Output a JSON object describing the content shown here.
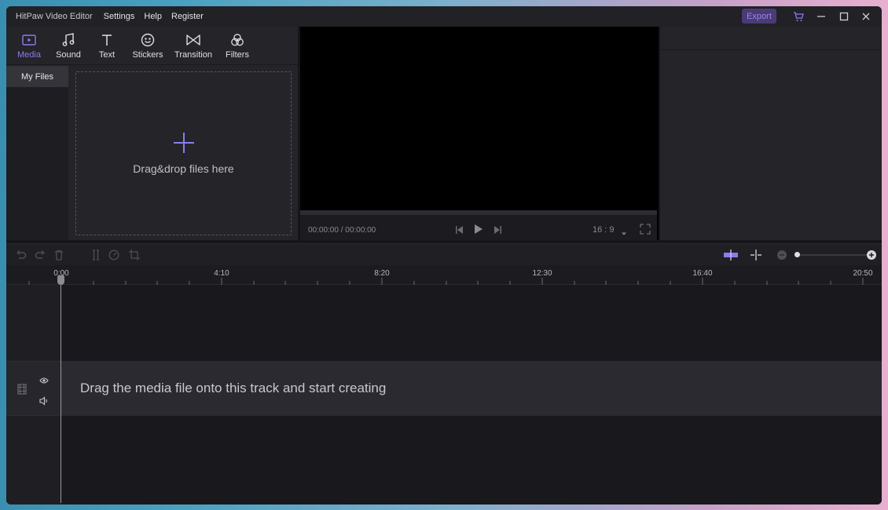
{
  "app": {
    "title": "HitPaw Video Editor"
  },
  "menu": {
    "items": [
      "Settings",
      "Help",
      "Register"
    ]
  },
  "titlebar": {
    "export_label": "Export"
  },
  "colors": {
    "accent": "#8a7cf0",
    "export_bg": "#4a3a78",
    "background": "#15151a"
  },
  "media_tabs": [
    {
      "label": "Media",
      "icon": "media-icon",
      "active": true
    },
    {
      "label": "Sound",
      "icon": "music-note-icon",
      "active": false
    },
    {
      "label": "Text",
      "icon": "text-icon",
      "active": false
    },
    {
      "label": "Stickers",
      "icon": "sticker-icon",
      "active": false
    },
    {
      "label": "Transition",
      "icon": "transition-icon",
      "active": false
    },
    {
      "label": "Filters",
      "icon": "filters-icon",
      "active": false
    }
  ],
  "library": {
    "my_files_label": "My Files",
    "drop_text": "Drag&drop files here"
  },
  "preview": {
    "timecode": "00:00:00 / 00:00:00",
    "aspect_ratio": "16 : 9"
  },
  "timeline": {
    "ruler_labels": [
      "0:00",
      "4:10",
      "8:20",
      "12:30",
      "16:40",
      "20:50"
    ],
    "main_track_hint": "Drag the media file onto this track and start creating"
  }
}
